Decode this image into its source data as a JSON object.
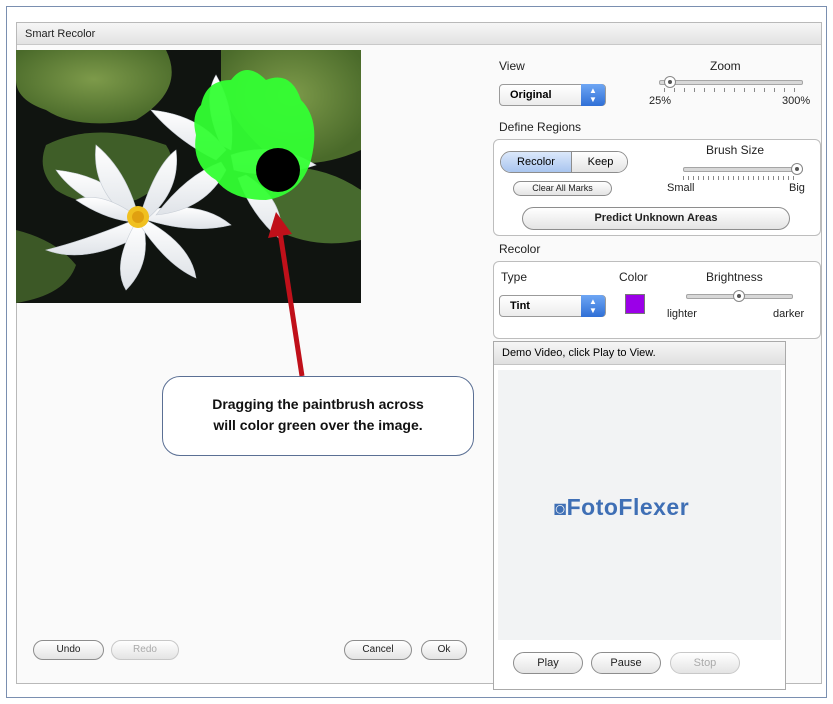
{
  "dialog": {
    "title": "Smart Recolor"
  },
  "view": {
    "label": "View",
    "selected": "Original"
  },
  "zoom": {
    "label": "Zoom",
    "min": "25%",
    "max": "300%",
    "level_percent": 25
  },
  "define_regions": {
    "label": "Define Regions",
    "recolor_tab": "Recolor",
    "keep_tab": "Keep",
    "clear_all": "Clear All Marks",
    "brush_size": {
      "label": "Brush Size",
      "small": "Small",
      "big": "Big",
      "level_fraction": 1.0
    },
    "predict": "Predict Unknown Areas"
  },
  "recolor": {
    "label": "Recolor",
    "type_label": "Type",
    "type_selected": "Tint",
    "color_label": "Color",
    "color_value": "#9b00e8",
    "brightness": {
      "label": "Brightness",
      "lighter": "lighter",
      "darker": "darker",
      "level_fraction": 0.5
    }
  },
  "demo": {
    "header": "Demo Video, click Play to View.",
    "logo": "FotoFlexer",
    "logo_icon": "camera-icon",
    "play": "Play",
    "pause": "Pause",
    "stop": "Stop"
  },
  "footer": {
    "undo": "Undo",
    "redo": "Redo",
    "cancel": "Cancel",
    "ok": "Ok"
  },
  "callout": {
    "line1": "Dragging the paintbrush across",
    "line2": "will color green over the image."
  },
  "colors": {
    "accent_blue": "#3b7be0",
    "mark_green": "#33ff33",
    "arrow_red": "#c0101a",
    "logo_blue": "#3f6fb5"
  }
}
